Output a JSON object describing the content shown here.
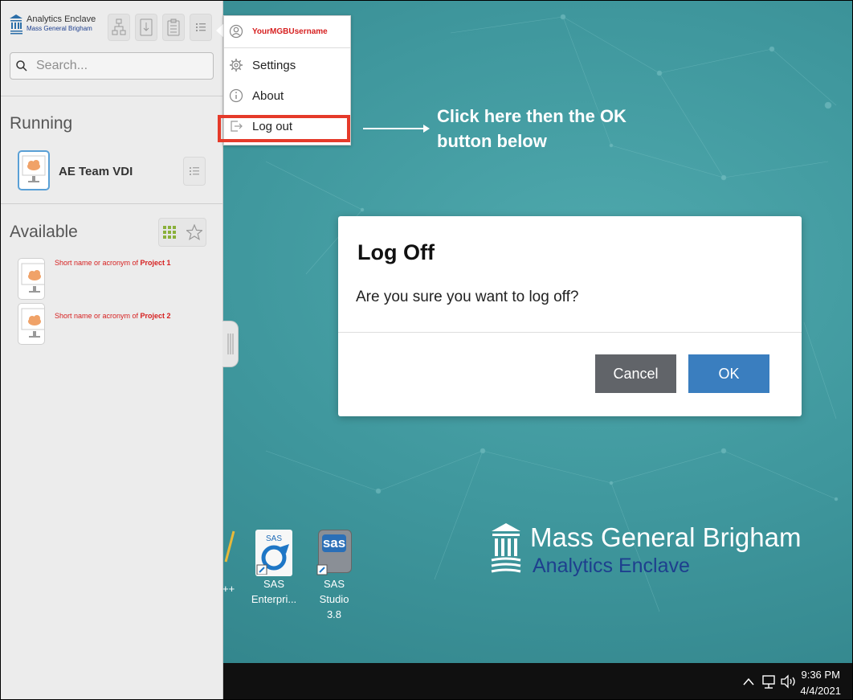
{
  "panel": {
    "logo": {
      "line1": "Analytics Enclave",
      "line2": "Mass General Brigham"
    },
    "search": {
      "placeholder": "Search..."
    },
    "running": {
      "title": "Running",
      "items": [
        {
          "label": "AE Team VDI"
        }
      ]
    },
    "available": {
      "title": "Available",
      "items": [
        {
          "prefix": "Short name  or acronym of ",
          "bold": "Project 1"
        },
        {
          "prefix": "Short name  or acronym of ",
          "bold": "Project 2"
        }
      ]
    }
  },
  "menu": {
    "username": "YourMGBUsername",
    "items": [
      {
        "label": "Settings",
        "icon": "gear-icon"
      },
      {
        "label": "About",
        "icon": "info-icon"
      },
      {
        "label": "Log out",
        "icon": "logout-icon"
      }
    ]
  },
  "annotation": {
    "line1": "Click here then the OK",
    "line2": "button below"
  },
  "dialog": {
    "title": "Log Off",
    "message": "Are you sure you want to log off?",
    "cancel_label": "Cancel",
    "ok_label": "OK"
  },
  "desktop": {
    "icons": [
      {
        "label_line1": "SAS",
        "label_line2": "Enterpri..."
      },
      {
        "label_line1": "SAS Studio",
        "label_line2": "3.8"
      }
    ],
    "partial_icon_label": "++",
    "sas_badge": "SAS",
    "sas_studio_badge": "sas",
    "brand": {
      "line1": "Mass General Brigham",
      "line2": "Analytics Enclave"
    }
  },
  "taskbar": {
    "time": "9:36 PM",
    "date": "4/4/2021"
  },
  "colors": {
    "dialog_ok": "#3a7ebf",
    "dialog_cancel": "#616469",
    "highlight": "#e53a2a",
    "username": "#d62020",
    "desktop": "#3f979d"
  }
}
